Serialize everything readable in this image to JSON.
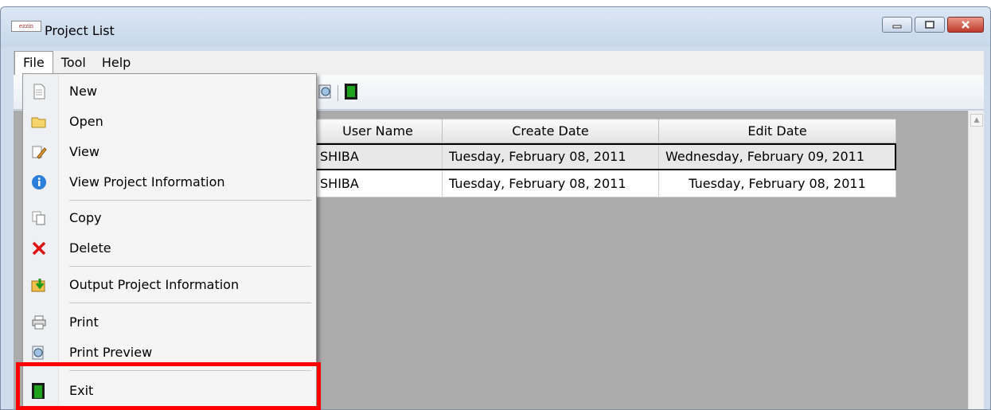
{
  "window": {
    "title": "Project List",
    "app_icon_text": "ezzin",
    "buttons": [
      "minimize",
      "maximize",
      "close"
    ]
  },
  "menubar": {
    "items": [
      {
        "label": "File",
        "active": true
      },
      {
        "label": "Tool",
        "active": false
      },
      {
        "label": "Help",
        "active": false
      }
    ]
  },
  "file_menu": {
    "items": [
      {
        "label": "New",
        "icon": "document-icon"
      },
      {
        "label": "Open",
        "icon": "folder-icon"
      },
      {
        "label": "View",
        "icon": "pencil-icon"
      },
      {
        "label": "View Project Information",
        "icon": "info-icon"
      },
      {
        "label": "Copy",
        "icon": "copy-icon"
      },
      {
        "label": "Delete",
        "icon": "delete-icon"
      },
      {
        "label": "Output Project Information",
        "icon": "export-icon"
      },
      {
        "label": "Print",
        "icon": "printer-icon"
      },
      {
        "label": "Print Preview",
        "icon": "print-preview-icon"
      },
      {
        "label": "Exit",
        "icon": "exit-icon"
      }
    ]
  },
  "table": {
    "columns": [
      "User Name",
      "Create Date",
      "Edit Date"
    ],
    "rows": [
      {
        "user": "SHIBA",
        "create": "Tuesday, February 08, 2011",
        "edit": "Wednesday, February 09, 2011",
        "selected": true
      },
      {
        "user": "SHIBA",
        "create": "Tuesday, February 08, 2011",
        "edit": "Tuesday, February 08, 2011",
        "selected": false
      }
    ]
  },
  "colors": {
    "highlight": "#ff0000",
    "grid_background": "#ababab"
  }
}
